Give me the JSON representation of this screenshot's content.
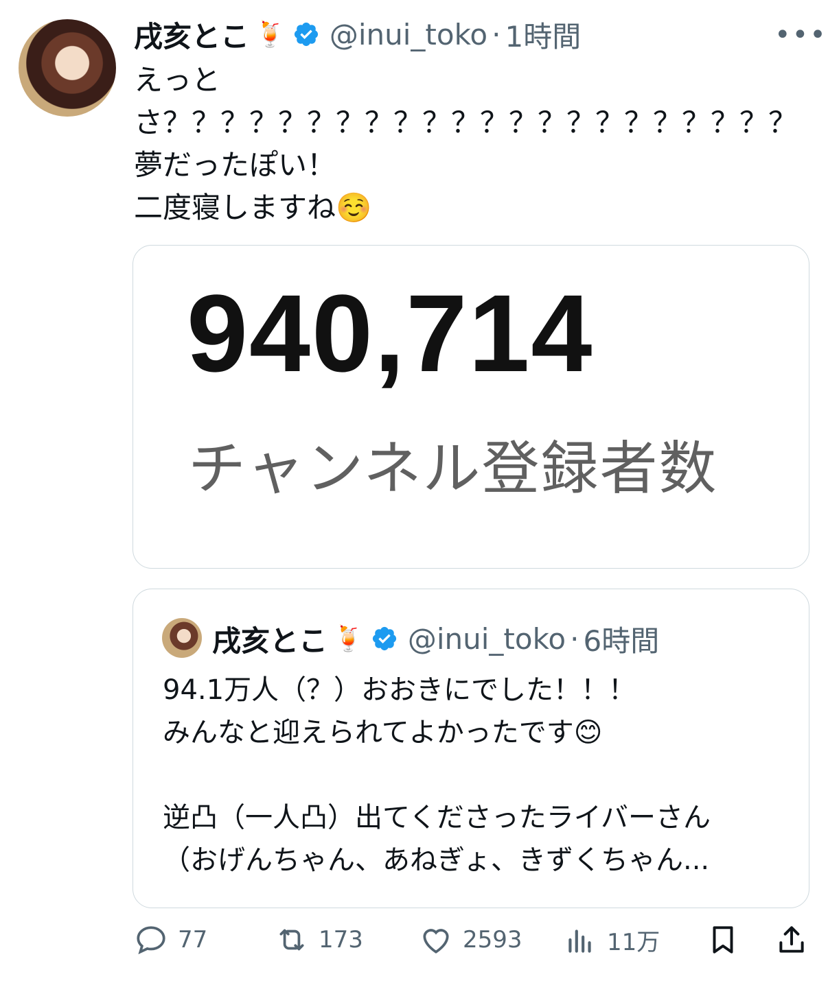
{
  "tweet": {
    "author_name": "戌亥とこ",
    "author_emoji": "🍹",
    "handle": "@inui_toko",
    "separator": "·",
    "time": "1時間",
    "more": "•••",
    "text": "えっと\nさ？？？？？？？？？？？？？？？？？？？？？？\n夢だったぽい！\n二度寝しますね☺️",
    "media": {
      "number": "940,714",
      "caption": "チャンネル登録者数"
    }
  },
  "quoted": {
    "author_name": "戌亥とこ",
    "author_emoji": "🍹",
    "handle": "@inui_toko",
    "separator": "·",
    "time": "6時間",
    "text": "94.1万人（？）おおきにでした！！！\nみんなと迎えられてよかったです😊\n\n逆凸（一人凸）出てくださったライバーさん\n（おげんちゃん、あねぎょ、きずくちゃん..."
  },
  "actions": {
    "replies": "77",
    "retweets": "173",
    "likes": "2593",
    "views": "11万"
  },
  "colors": {
    "verified": "#1d9bf0",
    "secondary": "#536471",
    "border": "#cfd9de"
  },
  "icons": [
    "reply-icon",
    "retweet-icon",
    "like-icon",
    "views-icon",
    "bookmark-icon",
    "share-icon",
    "verified-icon",
    "more-icon"
  ]
}
